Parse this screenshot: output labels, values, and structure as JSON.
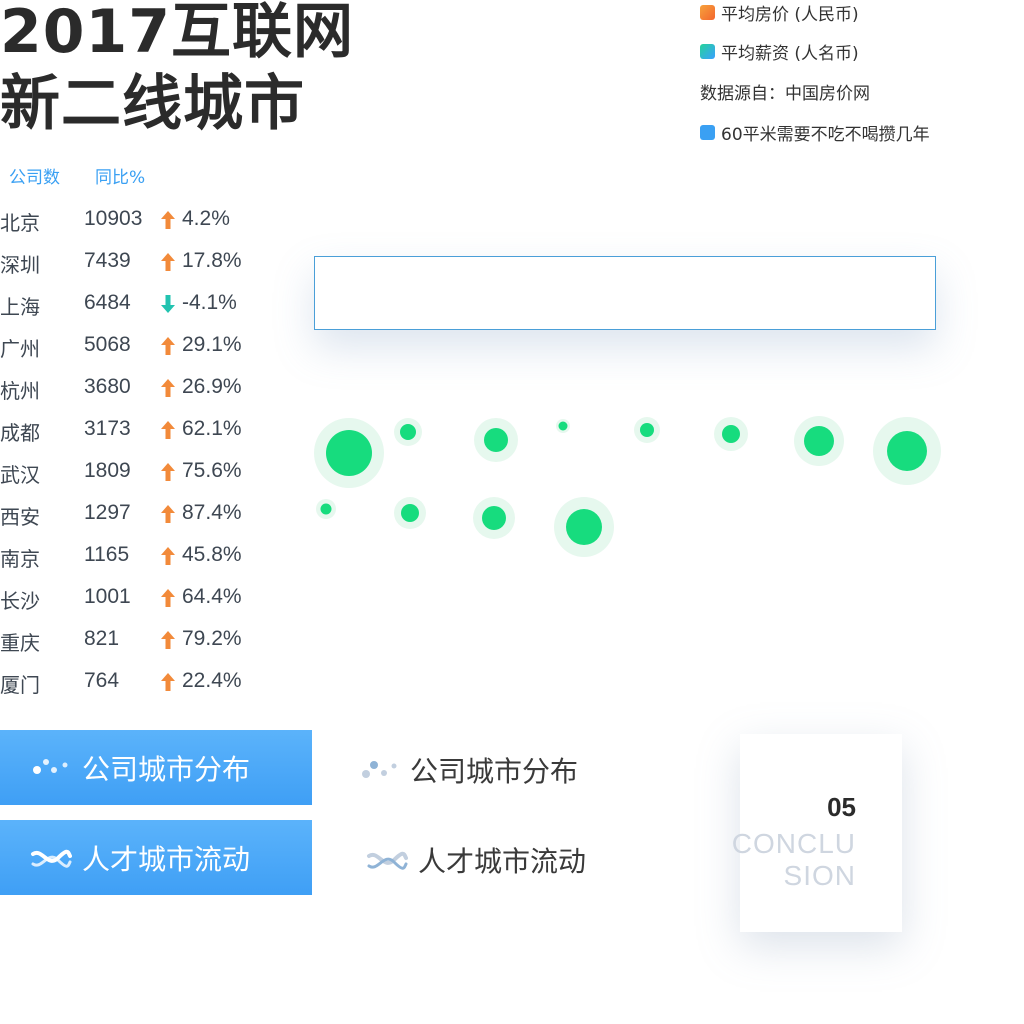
{
  "header": {
    "title_line1": "2017互联网",
    "title_line2": "新二线城市"
  },
  "legend": {
    "items": [
      {
        "label": "平均房价 (人民币)",
        "color": "#f4662e"
      },
      {
        "label": "平均薪资 (人名币)",
        "color": "#25d39a"
      },
      {
        "label": "数据源自：中国房价网"
      },
      {
        "label": "60平米需要不吃不喝攒几年",
        "color": "#3aa0f3"
      }
    ]
  },
  "table": {
    "headers": [
      "公司数",
      "同比%"
    ],
    "rows": [
      {
        "city": "北京",
        "count": "10903",
        "dir": "up",
        "pct": "4.2%"
      },
      {
        "city": "深圳",
        "count": "7439",
        "dir": "up",
        "pct": "17.8%"
      },
      {
        "city": "上海",
        "count": "6484",
        "dir": "down",
        "pct": "-4.1%"
      },
      {
        "city": "广州",
        "count": "5068",
        "dir": "up",
        "pct": "29.1%"
      },
      {
        "city": "杭州",
        "count": "3680",
        "dir": "up",
        "pct": "26.9%"
      },
      {
        "city": "成都",
        "count": "3173",
        "dir": "up",
        "pct": "62.1%"
      },
      {
        "city": "武汉",
        "count": "1809",
        "dir": "up",
        "pct": "75.6%"
      },
      {
        "city": "西安",
        "count": "1297",
        "dir": "up",
        "pct": "87.4%"
      },
      {
        "city": "南京",
        "count": "1165",
        "dir": "up",
        "pct": "45.8%"
      },
      {
        "city": "长沙",
        "count": "1001",
        "dir": "up",
        "pct": "64.4%"
      },
      {
        "city": "重庆",
        "count": "821",
        "dir": "up",
        "pct": "79.2%"
      },
      {
        "city": "厦门",
        "count": "764",
        "dir": "up",
        "pct": "22.4%"
      }
    ]
  },
  "colors": {
    "up_arrow": "#f28a3a",
    "down_arrow": "#22c3b0",
    "bubble": "#17dc7e",
    "bubble_halo": "#e6f8ee",
    "accent": "#3aa0f3"
  },
  "nav": {
    "company_distribution": "公司城市分布",
    "talent_flow": "人才城市流动"
  },
  "card": {
    "number": "05",
    "word_line1": "CONCLU",
    "word_line2": "SION"
  }
}
